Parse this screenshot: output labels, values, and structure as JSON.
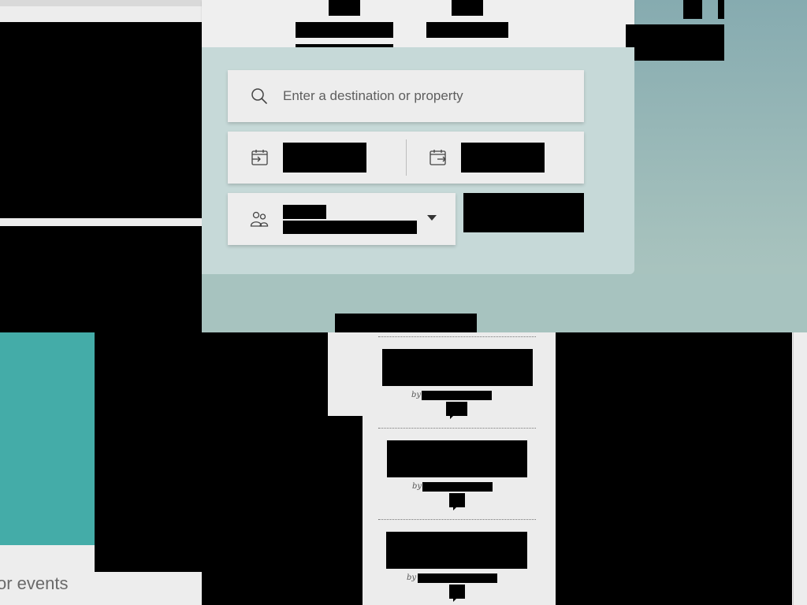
{
  "search": {
    "destination_placeholder": "Enter a destination or property",
    "icons": {
      "search": "search-icon",
      "check_in": "calendar-check-in-icon",
      "check_out": "calendar-check-out-icon",
      "guests": "guests-icon",
      "dropdown": "chevron-down-icon"
    }
  },
  "footer_text": {
    "events": "or events"
  },
  "articles": {
    "byline_prefix": "by"
  },
  "colors": {
    "teal_accent": "#44aca8",
    "hero_background": "#9cbcb8",
    "panel_background": "#c6d9d8"
  }
}
